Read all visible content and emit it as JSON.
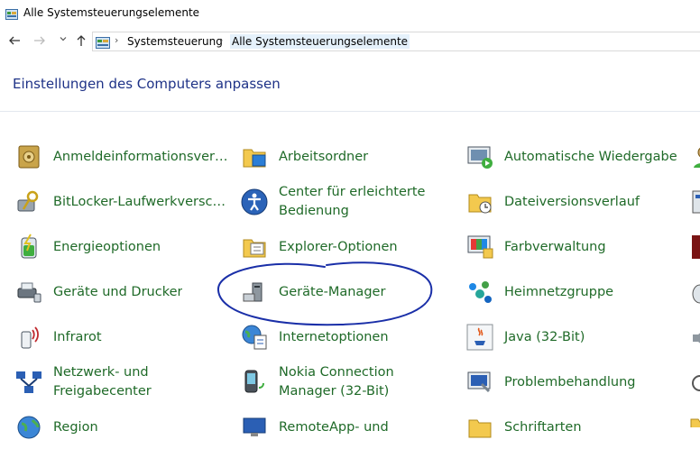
{
  "window": {
    "title": "Alle Systemsteuerungselemente"
  },
  "address": {
    "crumbs": [
      "Systemsteuerung",
      "Alle Systemsteuerungselemente"
    ]
  },
  "heading": "Einstellungen des Computers anpassen",
  "items": {
    "c1": [
      "Anmeldeinformationsverwaltung",
      "BitLocker-Laufwerkverschlüsselung",
      "Energieoptionen",
      "Geräte und Drucker",
      "Infrarot",
      "Netzwerk- und\nFreigabecenter",
      "Region"
    ],
    "c2": [
      "Arbeitsordner",
      "Center für erleichterte\nBedienung",
      "Explorer-Optionen",
      "Geräte-Manager",
      "Internetoptionen",
      "Nokia Connection\nManager (32-Bit)",
      "RemoteApp- und"
    ],
    "c3": [
      "Automatische Wiedergabe",
      "Dateiversionsverlauf",
      "Farbverwaltung",
      "Heimnetzgruppe",
      "Java (32-Bit)",
      "Problembehandlung",
      "Schriftarten"
    ]
  },
  "colors": {
    "link": "#1f6a28",
    "heading": "#1e3287",
    "annotation": "#1a2fa8"
  }
}
